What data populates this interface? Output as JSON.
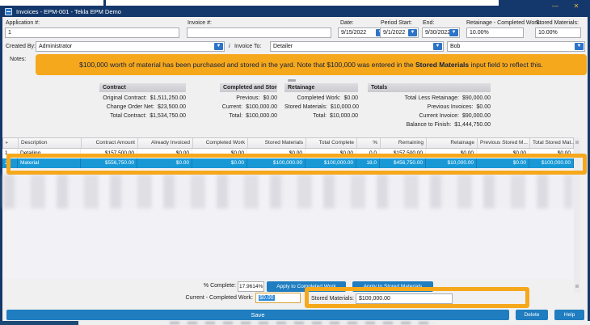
{
  "window": {
    "title": "Invoices - EPM-001 - Tekla EPM Demo",
    "minimize_glyph": "—",
    "close_glyph": "✕"
  },
  "fields": {
    "application_label": "Application #:",
    "application_value": "1",
    "invoice_label": "Invoice #:",
    "invoice_value": "",
    "date_label": "Date:",
    "date_value": "9/15/2022",
    "period_start_label": "Period Start:",
    "period_start_value": "9/1/2022",
    "end_label": "End:",
    "end_value": "9/30/2022",
    "retainage_label": "Retainage - Completed Work:",
    "retainage_value": "10.00%",
    "stored_materials_label": "Stored Materials:",
    "stored_materials_value": "10.00%",
    "created_by_label": "Created By:",
    "created_by_value": "Administrator",
    "info_glyph": "i",
    "invoice_to_label": "Invoice To:",
    "invoice_to_value": "Detailer",
    "approver_value": "Bob",
    "notes_label": "Notes:",
    "dropdown_glyph": "▼"
  },
  "note": {
    "pre": "$100,000 worth of material has been purchased and stored in the yard. Note that $100,000 was entered in the ",
    "bold": "Stored Materials",
    "post": " input field to reflect this."
  },
  "panels": {
    "contract": {
      "title": "Contract",
      "rows": [
        {
          "label": "Original Contract:",
          "value": "$1,511,250.00"
        },
        {
          "label": "Change Order Net:",
          "value": "$23,500.00"
        },
        {
          "label": "Total Contract:",
          "value": "$1,534,750.00"
        }
      ]
    },
    "completed": {
      "title": "Completed and Stored",
      "rows": [
        {
          "label": "Previous:",
          "value": "$0.00"
        },
        {
          "label": "Current:",
          "value": "$100,000.00"
        },
        {
          "label": "Total:",
          "value": "$100,000.00"
        }
      ]
    },
    "retainage": {
      "title": "Retainage",
      "rows": [
        {
          "label": "Completed Work:",
          "value": "$0.00"
        },
        {
          "label": "Stored Materials:",
          "value": "$10,000.00"
        },
        {
          "label": "Total:",
          "value": "$10,000.00"
        }
      ]
    },
    "totals": {
      "title": "Totals",
      "rows": [
        {
          "label": "Total Less Retainage:",
          "value": "$90,000.00"
        },
        {
          "label": "Previous Invoices:",
          "value": "$0.00"
        },
        {
          "label": "Current Invoice:",
          "value": "$90,000.00"
        },
        {
          "label": "Balance to Finish:",
          "value": "$1,444,750.00"
        }
      ]
    }
  },
  "grid": {
    "columns": [
      "",
      "Description",
      "Contract Amount",
      "Already Invoiced",
      "Completed Work",
      "Stored Materials",
      "Total Complete",
      "%",
      "Remaining",
      "Retainage",
      "Previous Stored M...",
      "Total Stored Mat..."
    ],
    "rows": [
      {
        "cells": [
          "1",
          "Detailing",
          "$157,500.00",
          "$0.00",
          "$0.00",
          "$0.00",
          "$0.00",
          "0.0",
          "$157,500.00",
          "$0.00",
          "$0.00",
          "$0.00"
        ],
        "selected": false
      },
      {
        "cells": [
          "2",
          "Material",
          "$556,750.00",
          "$0.00",
          "$0.00",
          "$100,000.00",
          "$100,000.00",
          "18.0",
          "$456,750.00",
          "$10,000.00",
          "$0.00",
          "$100,000.00"
        ],
        "selected": true
      }
    ]
  },
  "footer": {
    "percent_complete_label": "% Complete:",
    "percent_complete_value": "17.9614%",
    "apply_completed_label": "Apply to Completed Work",
    "apply_stored_label": "Apply to Stored Materials",
    "current_completed_label": "Current - Completed Work:",
    "current_completed_value": "$0.00",
    "stored_materials_label": "Stored Materials:",
    "stored_materials_value": "$100,000.00",
    "save_label": "Save",
    "delete_label": "Delete",
    "help_label": "Help"
  },
  "colors": {
    "title_navy": "#14386b",
    "annotation_orange": "#f6a81c",
    "selected_row_blue": "#1899d6",
    "button_blue": "#1f7dc0"
  }
}
